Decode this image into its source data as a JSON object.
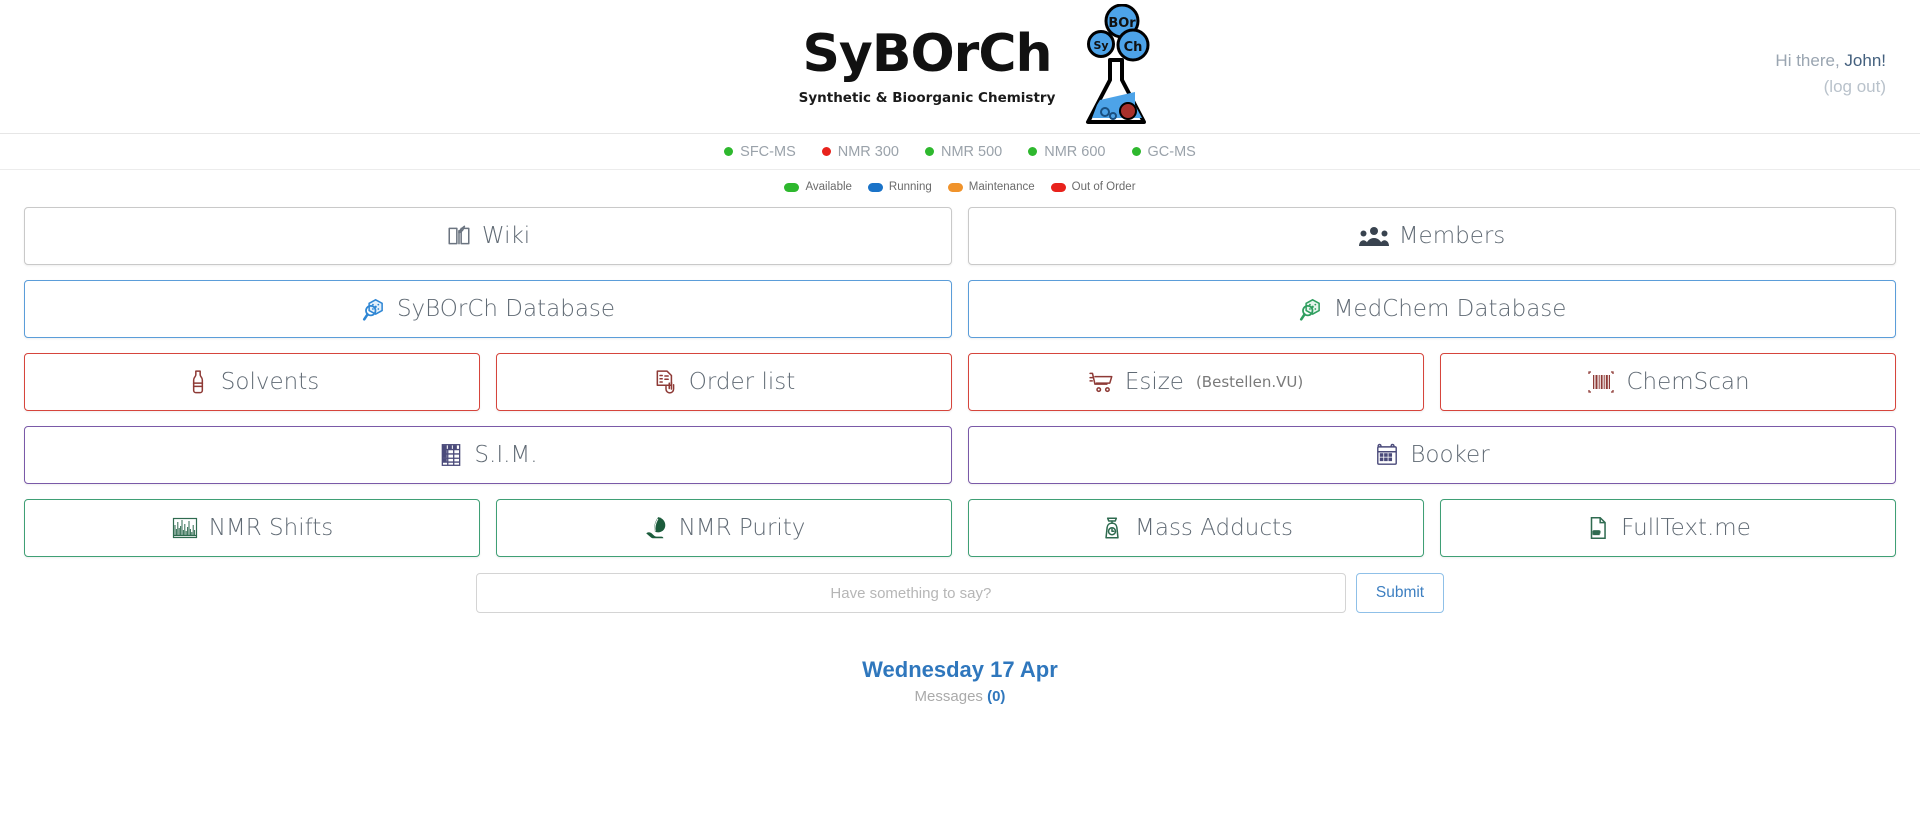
{
  "header": {
    "brand_title": "SyBOrCh",
    "brand_subtitle": "Synthetic & Bioorganic Chemistry",
    "logo_bubbles": [
      "BOr",
      "Sy",
      "Ch"
    ],
    "greeting_prefix": "Hi there,",
    "greeting_name": "John!",
    "logout_label": "(log out)"
  },
  "instrument_status": {
    "items": [
      {
        "label": "SFC-MS",
        "color": "#2eb82e"
      },
      {
        "label": "NMR 300",
        "color": "#e8221c"
      },
      {
        "label": "NMR 500",
        "color": "#2eb82e"
      },
      {
        "label": "NMR 600",
        "color": "#2eb82e"
      },
      {
        "label": "GC-MS",
        "color": "#2eb82e"
      }
    ],
    "legend": [
      {
        "label": "Available",
        "color": "#2eb82e"
      },
      {
        "label": "Running",
        "color": "#1a73c8"
      },
      {
        "label": "Maintenance",
        "color": "#f0932b"
      },
      {
        "label": "Out of Order",
        "color": "#e8221c"
      }
    ]
  },
  "tiles": {
    "rows": [
      {
        "accent": "#c9c9c9",
        "items": [
          {
            "label": "Wiki",
            "icon": "book-quill-icon",
            "sub": ""
          },
          {
            "label": "Members",
            "icon": "people-group-icon",
            "sub": ""
          }
        ]
      },
      {
        "accent": "#5b9dd9",
        "items": [
          {
            "label": "SyBOrCh Database",
            "icon": "magnifier-hexagon-blue-icon",
            "sub": ""
          },
          {
            "label": "MedChem Database",
            "icon": "magnifier-hexagon-green-icon",
            "sub": ""
          }
        ]
      },
      {
        "accent": "#d6453c",
        "items": [
          {
            "label": "Solvents",
            "icon": "bottle-icon",
            "sub": ""
          },
          {
            "label": "Order list",
            "icon": "checklist-hand-icon",
            "sub": ""
          },
          {
            "label": "Esize",
            "icon": "shopping-cart-icon",
            "sub": "(Bestellen.VU)"
          },
          {
            "label": "ChemScan",
            "icon": "barcode-icon",
            "sub": ""
          }
        ]
      },
      {
        "accent": "#7a5aa8",
        "items": [
          {
            "label": "S.I.M.",
            "icon": "table-grid-icon",
            "sub": ""
          },
          {
            "label": "Booker",
            "icon": "calendar-icon",
            "sub": ""
          }
        ]
      },
      {
        "accent": "#3f9f75",
        "items": [
          {
            "label": "NMR Shifts",
            "icon": "spectrum-icon",
            "sub": ""
          },
          {
            "label": "NMR Purity",
            "icon": "leaf-hand-icon",
            "sub": ""
          },
          {
            "label": "Mass Adducts",
            "icon": "balance-scale-icon",
            "sub": ""
          },
          {
            "label": "FullText.me",
            "icon": "pdf-file-icon",
            "sub": ""
          }
        ]
      }
    ]
  },
  "comment": {
    "placeholder": "Have something to say?",
    "value": "",
    "submit_label": "Submit"
  },
  "footer": {
    "date": "Wednesday 17 Apr",
    "messages_label": "Messages",
    "messages_count": "(0)"
  }
}
